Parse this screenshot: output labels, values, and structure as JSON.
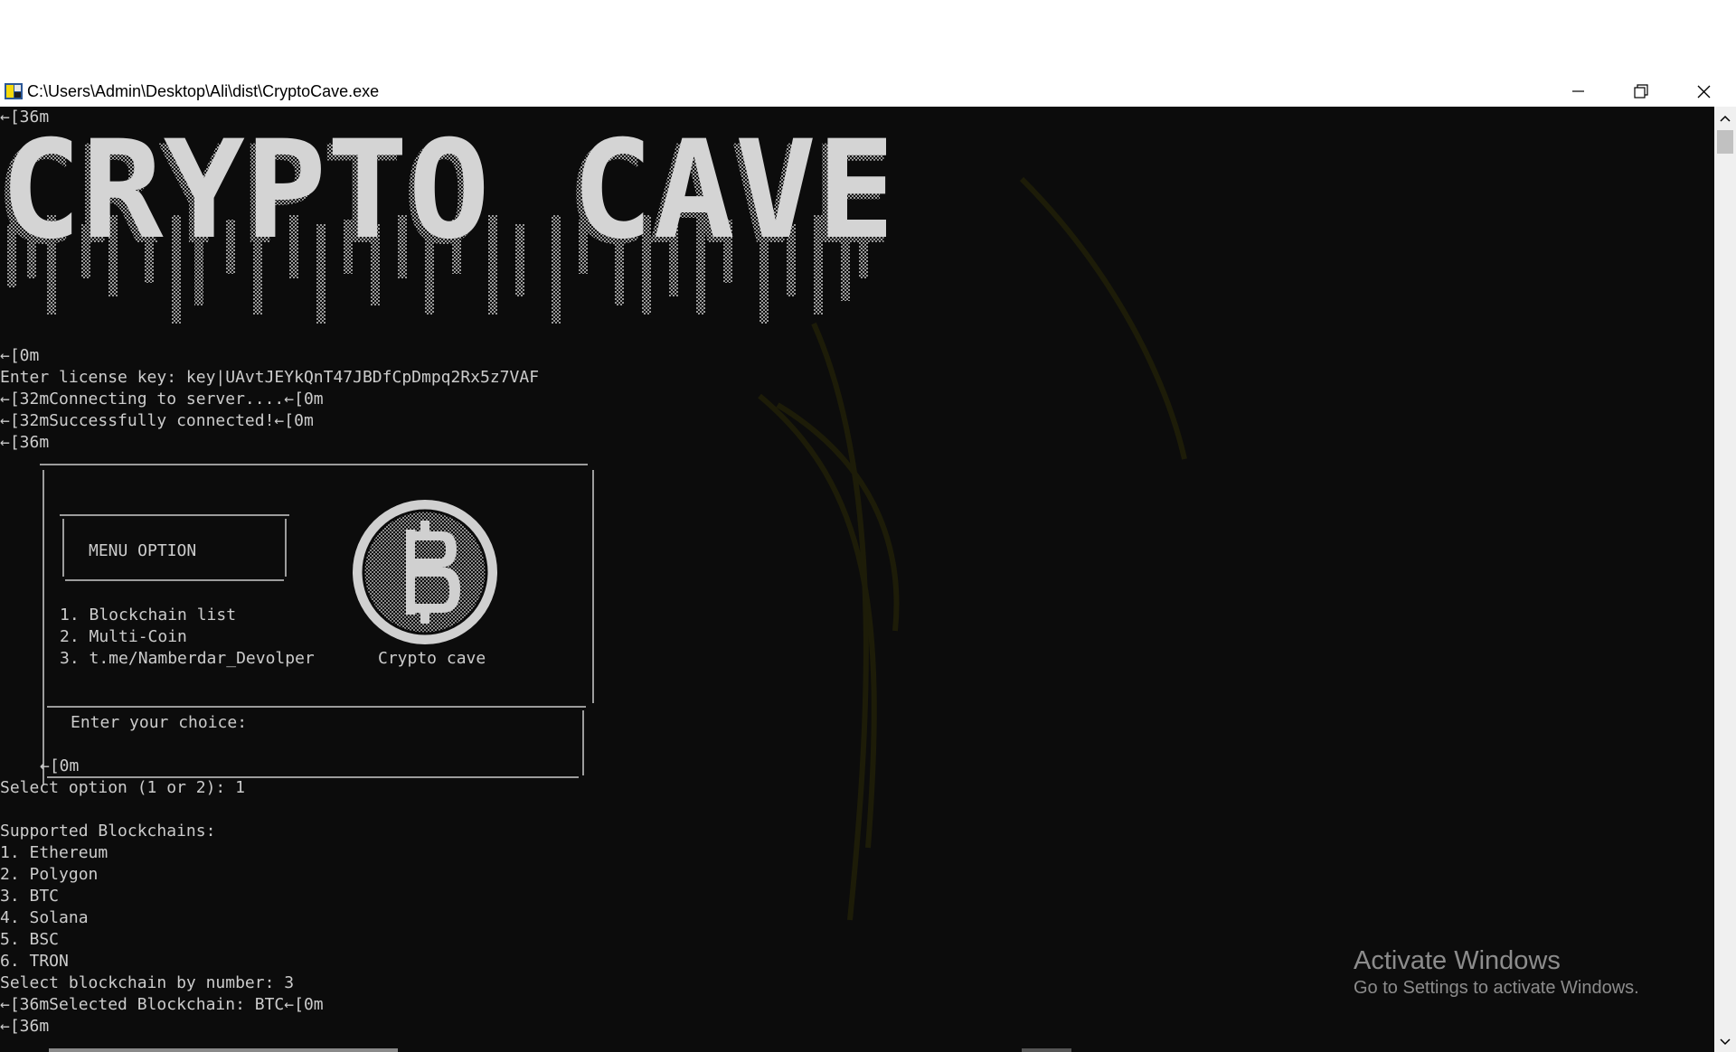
{
  "window": {
    "title": "C:\\Users\\Admin\\Desktop\\Ali\\dist\\CryptoCave.exe",
    "buttons": {
      "minimize_icon": "minimize-icon",
      "restore_icon": "restore-icon",
      "close_icon": "close-icon"
    }
  },
  "banner": {
    "prefix": "←[36m",
    "suffix": "←[0m",
    "logo_text": "CRYPTO CAVE"
  },
  "license": {
    "prompt": "Enter license key: key|UAvtJEYkQnT47JBDfCpDmpq2Rx5z7VAF"
  },
  "status": {
    "connecting": "←[32mConnecting to server....←[0m",
    "connected": "←[32mSuccessfully connected!←[0m",
    "menu_prefix": "←[36m"
  },
  "menu": {
    "title": "MENU OPTION",
    "items": [
      "1. Blockchain list",
      "2. Multi-Coin",
      "3. t.me/Namberdar_Devolper"
    ],
    "logo_caption": "Crypto cave",
    "choice_prompt": "Enter your choice:",
    "suffix": "←[0m"
  },
  "selection": {
    "option_prompt": "Select option (1 or 2): 1",
    "supported_header": "Supported Blockchains:",
    "blockchains": [
      "1. Ethereum",
      "2. Polygon",
      "3. BTC",
      "4. Solana",
      "5. BSC",
      "6. TRON"
    ],
    "select_prompt": "Select blockchain by number: 3",
    "selected": "←[36mSelected Blockchain: BTC←[0m",
    "last_prefix": "←[36m"
  },
  "watermark": {
    "title": "Activate Windows",
    "subtitle": "Go to Settings to activate Windows."
  },
  "colors": {
    "console_bg": "#0c0c0c",
    "console_text": "#cccccc",
    "watermark": "#8c8c8c",
    "accent_yellow": "#f5d90a"
  }
}
